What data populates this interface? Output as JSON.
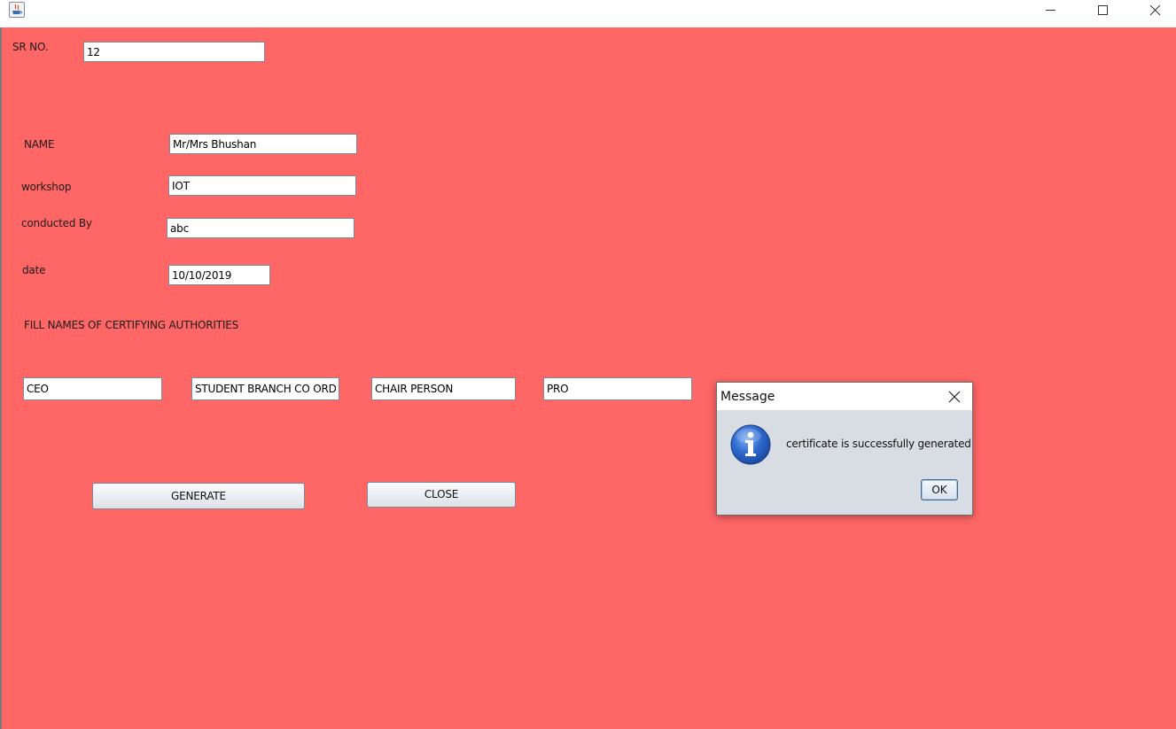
{
  "window": {
    "title": "",
    "controls": {
      "minimize_icon": "minimize-icon",
      "maximize_icon": "maximize-icon",
      "close_icon": "close-icon"
    },
    "background_color": "#ff6666"
  },
  "form": {
    "sr_no": {
      "label": "SR NO.",
      "value": "12"
    },
    "name": {
      "label": "NAME",
      "value": "Mr/Mrs Bhushan"
    },
    "workshop": {
      "label": "workshop",
      "value": "IOT"
    },
    "conducted_by": {
      "label": "conducted By",
      "value": "abc"
    },
    "date": {
      "label": "date",
      "value": "10/10/2019"
    },
    "authorities_heading": "FILL NAMES OF CERTIFYING AUTHORITIES",
    "authorities": [
      {
        "value": "CEO"
      },
      {
        "value": "STUDENT BRANCH CO ORDINATOR"
      },
      {
        "value": "CHAIR PERSON"
      },
      {
        "value": "PRO"
      }
    ],
    "generate_label": "GENERATE",
    "close_label": "CLOSE"
  },
  "dialog": {
    "title": "Message",
    "icon": "info-icon",
    "message": "certificate is successfully generated",
    "ok_label": "OK",
    "accent_color": "#2f6bd0"
  }
}
